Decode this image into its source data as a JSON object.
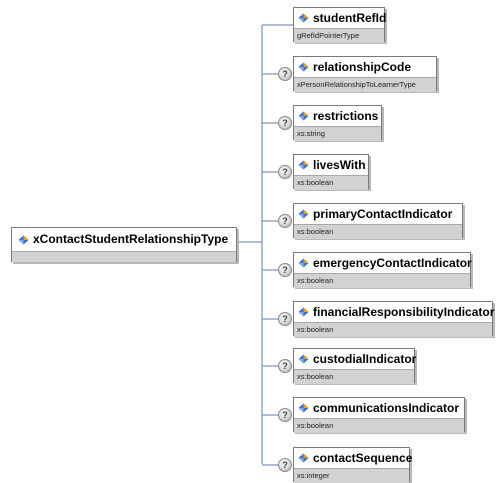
{
  "root": {
    "name": "xContactStudentRelationshipType"
  },
  "elements": [
    {
      "name": "studentRefId",
      "type": "gRefIdPointerType",
      "optional": false
    },
    {
      "name": "relationshipCode",
      "type": "xPersonRelationshipToLearnerType",
      "optional": true
    },
    {
      "name": "restrictions",
      "type": "xs:string",
      "optional": true
    },
    {
      "name": "livesWith",
      "type": "xs:boolean",
      "optional": true
    },
    {
      "name": "primaryContactIndicator",
      "type": "xs:boolean",
      "optional": true
    },
    {
      "name": "emergencyContactIndicator",
      "type": "xs:boolean",
      "optional": true
    },
    {
      "name": "financialResponsibilityIndicator",
      "type": "xs:boolean",
      "optional": true
    },
    {
      "name": "custodialIndicator",
      "type": "xs:boolean",
      "optional": true
    },
    {
      "name": "communicationsIndicator",
      "type": "xs:boolean",
      "optional": true
    },
    {
      "name": "contactSequence",
      "type": "xs:integer",
      "optional": true
    }
  ],
  "colors": {
    "connector": "#5b7fae",
    "type_band": "#d2d2d2",
    "icon_blue": "#3a6fd0",
    "icon_gold": "#e0a020"
  }
}
